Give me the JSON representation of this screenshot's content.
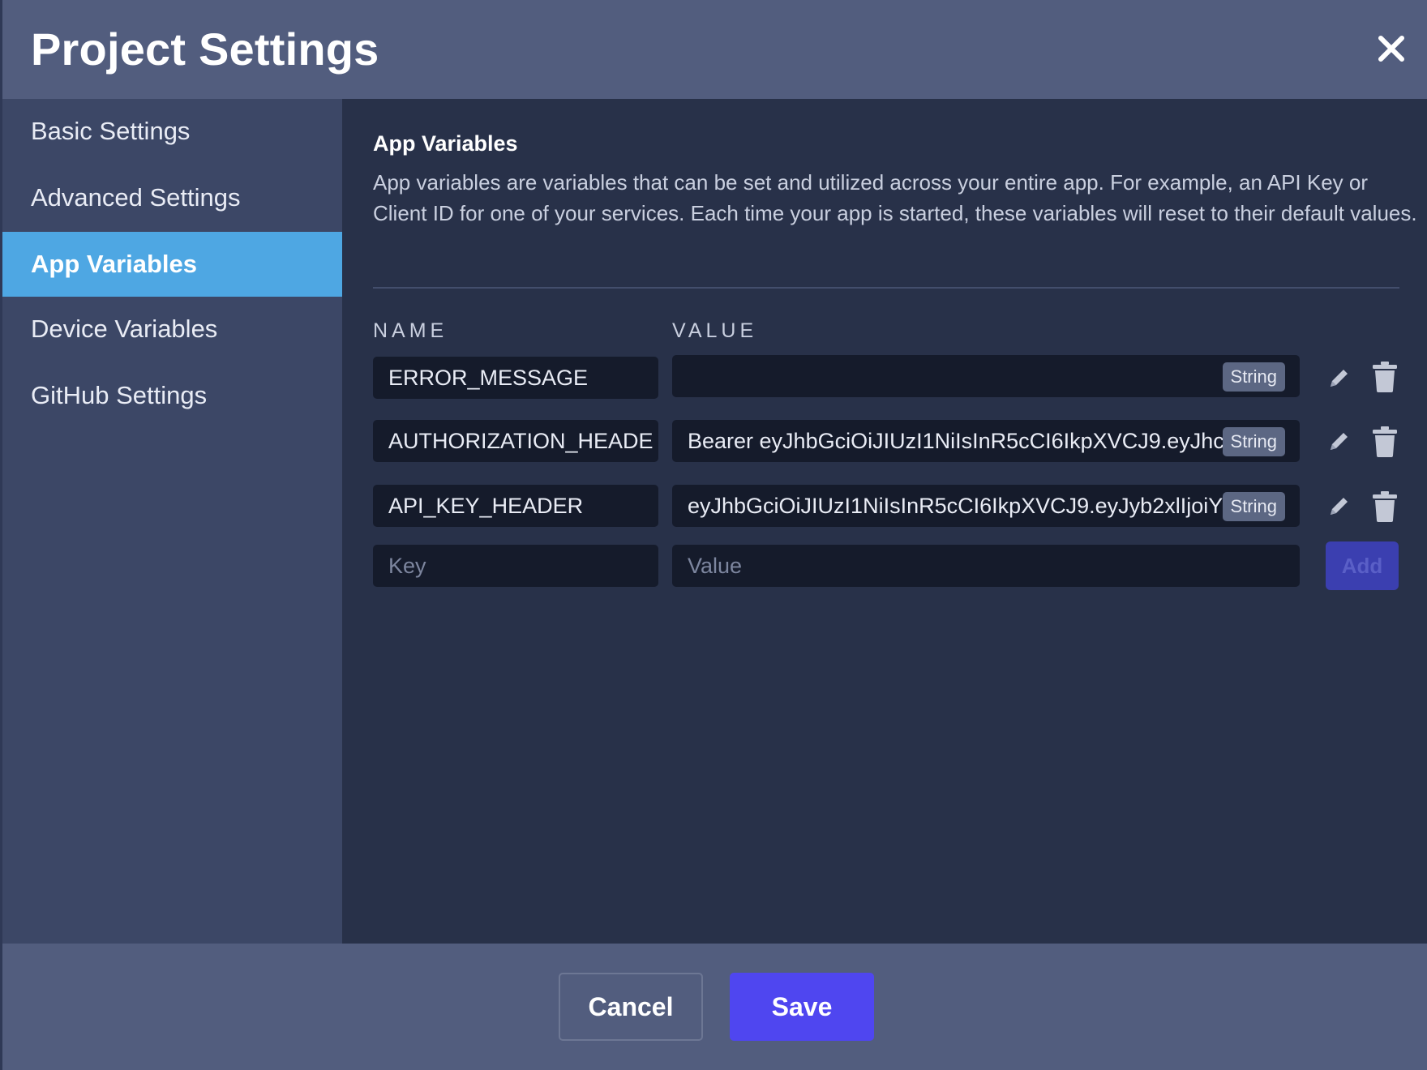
{
  "dialog": {
    "title": "Project Settings",
    "close_icon": "close-icon"
  },
  "sidebar": {
    "items": [
      {
        "label": "Basic Settings",
        "active": false
      },
      {
        "label": "Advanced Settings",
        "active": false
      },
      {
        "label": "App Variables",
        "active": true
      },
      {
        "label": "Device Variables",
        "active": false
      },
      {
        "label": "GitHub Settings",
        "active": false
      }
    ]
  },
  "content": {
    "title": "App Variables",
    "description": "App variables are variables that can be set and utilized across your entire app. For example, an API Key or Client ID for one of your services. Each time your app is started, these variables will reset to their default values.",
    "columns": {
      "name": "NAME",
      "value": "VALUE"
    },
    "variables": [
      {
        "name": "ERROR_MESSAGE",
        "value": "",
        "type": "String"
      },
      {
        "name": "AUTHORIZATION_HEADE",
        "value": "Bearer eyJhbGciOiJIUzI1NiIsInR5cCI6IkpXVCJ9.eyJhc",
        "type": "String"
      },
      {
        "name": "API_KEY_HEADER",
        "value": "eyJhbGciOiJIUzI1NiIsInR5cCI6IkpXVCJ9.eyJyb2xlIjoiY",
        "type": "String"
      }
    ],
    "new_variable": {
      "key_placeholder": "Key",
      "value_placeholder": "Value",
      "add_label": "Add"
    },
    "icons": {
      "edit": "pencil-icon",
      "delete": "trash-icon"
    }
  },
  "footer": {
    "cancel_label": "Cancel",
    "save_label": "Save"
  },
  "colors": {
    "header_bg": "#525d7e",
    "sidebar_bg": "#3c4766",
    "content_bg": "#283149",
    "active_nav": "#4ea7e3",
    "field_bg": "#151b2b",
    "save_button": "#4f46f0",
    "add_button_disabled": "#3b3fb0"
  }
}
